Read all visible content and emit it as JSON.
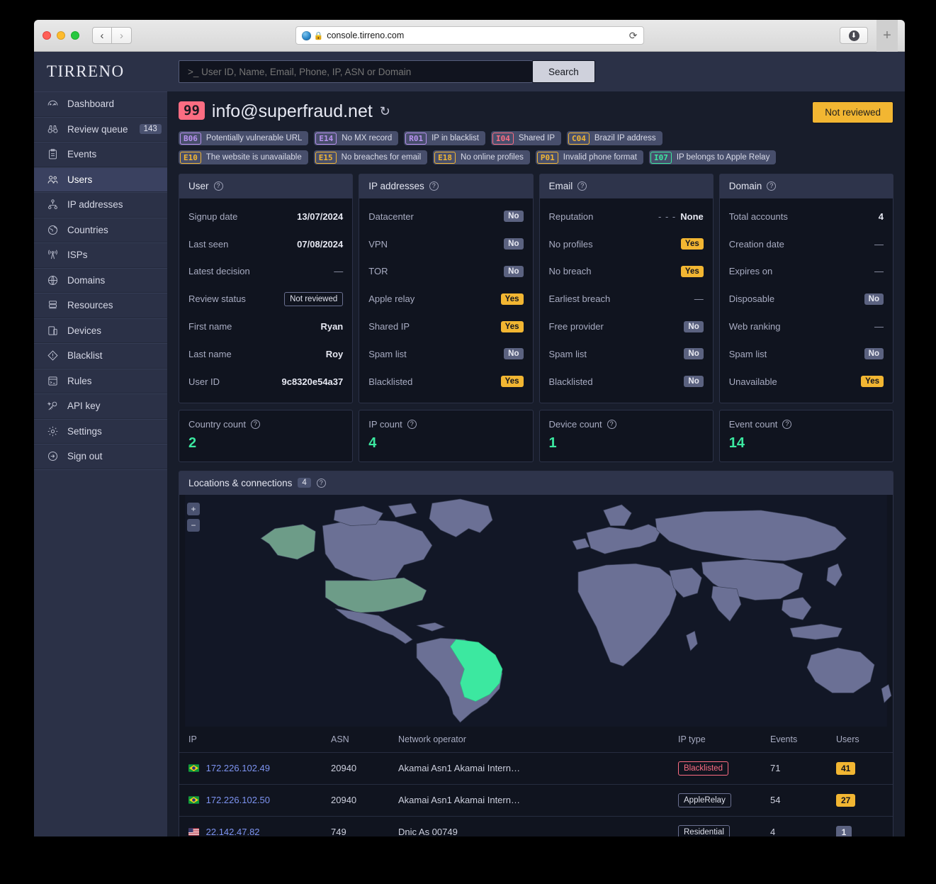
{
  "browser": {
    "url": "console.tirreno.com",
    "lock_icon": "lock-icon",
    "reload_icon": "reload-icon",
    "back_icon": "back-arrow-icon",
    "forward_icon": "forward-arrow-icon",
    "download_icon": "download-icon",
    "new_tab_label": "+"
  },
  "sidebar": {
    "brand": "TIRRENO",
    "items": [
      {
        "label": "Dashboard",
        "icon": "gauge-icon"
      },
      {
        "label": "Review queue",
        "icon": "binoculars-icon",
        "badge": "143"
      },
      {
        "label": "Events",
        "icon": "clipboard-icon"
      },
      {
        "label": "Users",
        "icon": "users-icon",
        "active": true
      },
      {
        "label": "IP addresses",
        "icon": "network-icon"
      },
      {
        "label": "Countries",
        "icon": "globe-icon"
      },
      {
        "label": "ISPs",
        "icon": "antenna-icon"
      },
      {
        "label": "Domains",
        "icon": "www-globe-icon"
      },
      {
        "label": "Resources",
        "icon": "server-icon"
      },
      {
        "label": "Devices",
        "icon": "devices-icon"
      },
      {
        "label": "Blacklist",
        "icon": "warning-diamond-icon"
      },
      {
        "label": "Rules",
        "icon": "terminal-box-icon"
      },
      {
        "label": "API key",
        "icon": "key-icon"
      },
      {
        "label": "Settings",
        "icon": "gear-icon"
      },
      {
        "label": "Sign out",
        "icon": "signout-icon"
      }
    ]
  },
  "search": {
    "placeholder": ">_ User ID, Name, Email, Phone, IP, ASN or Domain",
    "value": "",
    "button_label": "Search"
  },
  "header": {
    "score": "99",
    "title": "info@superfraud.net",
    "refresh_icon": "refresh-icon",
    "review_button": "Not reviewed"
  },
  "tags": [
    {
      "code": "B06",
      "label": "Potentially vulnerable URL",
      "color_class": "c-purple",
      "color": "#b892f0"
    },
    {
      "code": "E14",
      "label": "No MX record",
      "color_class": "c-purple",
      "color": "#b892f0"
    },
    {
      "code": "R01",
      "label": "IP in blacklist",
      "color_class": "c-purple",
      "color": "#b892f0"
    },
    {
      "code": "I04",
      "label": "Shared IP",
      "color_class": "c-red",
      "color": "#fc6d82"
    },
    {
      "code": "C04",
      "label": "Brazil IP address",
      "color_class": "c-orange",
      "color": "#f2b632"
    },
    {
      "code": "E10",
      "label": "The website is unavailable",
      "color_class": "c-orange",
      "color": "#f2b632"
    },
    {
      "code": "E15",
      "label": "No breaches for email",
      "color_class": "c-orange",
      "color": "#f2b632"
    },
    {
      "code": "E18",
      "label": "No online profiles",
      "color_class": "c-orange",
      "color": "#f2b632"
    },
    {
      "code": "P01",
      "label": "Invalid phone format",
      "color_class": "c-orange",
      "color": "#f2b632"
    },
    {
      "code": "I07",
      "label": "IP belongs to Apple Relay",
      "color_class": "c-green",
      "color": "#3ce8a0"
    }
  ],
  "panels": [
    {
      "title": "User",
      "rows": [
        {
          "label": "Signup date",
          "value": "13/07/2024",
          "kind": "text"
        },
        {
          "label": "Last seen",
          "value": "07/08/2024",
          "kind": "text"
        },
        {
          "label": "Latest decision",
          "value": "—",
          "kind": "dim"
        },
        {
          "label": "Review status",
          "value": "Not reviewed",
          "kind": "outline"
        },
        {
          "label": "First name",
          "value": "Ryan",
          "kind": "text"
        },
        {
          "label": "Last name",
          "value": "Roy",
          "kind": "text"
        },
        {
          "label": "User ID",
          "value": "9c8320e54a37",
          "kind": "text"
        }
      ]
    },
    {
      "title": "IP addresses",
      "rows": [
        {
          "label": "Datacenter",
          "value": "No",
          "kind": "no"
        },
        {
          "label": "VPN",
          "value": "No",
          "kind": "no"
        },
        {
          "label": "TOR",
          "value": "No",
          "kind": "no"
        },
        {
          "label": "Apple relay",
          "value": "Yes",
          "kind": "yes"
        },
        {
          "label": "Shared IP",
          "value": "Yes",
          "kind": "yes"
        },
        {
          "label": "Spam list",
          "value": "No",
          "kind": "no"
        },
        {
          "label": "Blacklisted",
          "value": "Yes",
          "kind": "yes"
        }
      ]
    },
    {
      "title": "Email",
      "rows": [
        {
          "label": "Reputation",
          "value": "None",
          "kind": "reputation",
          "prefix": "- - -"
        },
        {
          "label": "No profiles",
          "value": "Yes",
          "kind": "yes"
        },
        {
          "label": "No breach",
          "value": "Yes",
          "kind": "yes"
        },
        {
          "label": "Earliest breach",
          "value": "—",
          "kind": "dim"
        },
        {
          "label": "Free provider",
          "value": "No",
          "kind": "no"
        },
        {
          "label": "Spam list",
          "value": "No",
          "kind": "no"
        },
        {
          "label": "Blacklisted",
          "value": "No",
          "kind": "no"
        }
      ]
    },
    {
      "title": "Domain",
      "rows": [
        {
          "label": "Total accounts",
          "value": "4",
          "kind": "text"
        },
        {
          "label": "Creation date",
          "value": "—",
          "kind": "dim"
        },
        {
          "label": "Expires on",
          "value": "—",
          "kind": "dim"
        },
        {
          "label": "Disposable",
          "value": "No",
          "kind": "no"
        },
        {
          "label": "Web ranking",
          "value": "—",
          "kind": "dim"
        },
        {
          "label": "Spam list",
          "value": "No",
          "kind": "no"
        },
        {
          "label": "Unavailable",
          "value": "Yes",
          "kind": "yes"
        }
      ]
    }
  ],
  "counters": [
    {
      "label": "Country count",
      "value": "2"
    },
    {
      "label": "IP count",
      "value": "4"
    },
    {
      "label": "Device count",
      "value": "1"
    },
    {
      "label": "Event count",
      "value": "14"
    }
  ],
  "map": {
    "title": "Locations & connections",
    "count": "4",
    "zoom_in": "+",
    "zoom_out": "−",
    "highlight_colors": {
      "primary": "#3ce8a0",
      "secondary": "#6d9c88",
      "base": "#6b7095",
      "ocean": "#121726"
    },
    "highlighted_countries": [
      "Brazil",
      "United States",
      "Alaska"
    ]
  },
  "table": {
    "columns": [
      "IP",
      "ASN",
      "Network operator",
      "IP type",
      "Events",
      "Users"
    ],
    "rows": [
      {
        "flag": "br",
        "ip": "172.226.102.49",
        "asn": "20940",
        "operator": "Akamai Asn1 Akamai Intern…",
        "type": "Blacklisted",
        "type_style": "bl",
        "events": "71",
        "users": "41",
        "users_style": "yellow"
      },
      {
        "flag": "br",
        "ip": "172.226.102.50",
        "asn": "20940",
        "operator": "Akamai Asn1 Akamai Intern…",
        "type": "AppleRelay",
        "type_style": "norm",
        "events": "54",
        "users": "27",
        "users_style": "yellow"
      },
      {
        "flag": "us",
        "ip": "22.142.47.82",
        "asn": "749",
        "operator": "Dnic As 00749",
        "type": "Residential",
        "type_style": "norm",
        "events": "4",
        "users": "1",
        "users_style": "grey"
      }
    ]
  }
}
